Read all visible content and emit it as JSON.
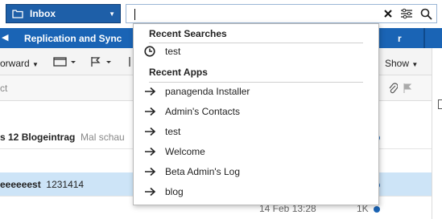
{
  "folder": {
    "label": "Inbox",
    "icon": "folder-icon"
  },
  "search": {
    "value": "",
    "icons": [
      "clear-icon",
      "filter-icon",
      "search-icon"
    ]
  },
  "tabbar": {
    "tab_label": "Replication and Sync",
    "close_glyph": "x",
    "right_tab_fragment": "r"
  },
  "toolbar": {
    "forward_label": "orward",
    "show_label": "Show"
  },
  "column_header": {
    "subject_fragment": "ct"
  },
  "rows": [
    {
      "subject": "s 12 Blogeintrag",
      "preview": "Mal schau"
    },
    {
      "subject": "eeeeeest",
      "preview": "1231414"
    }
  ],
  "bottom_row": {
    "date": "14 Feb 13:28",
    "size": "1K"
  },
  "dropdown": {
    "recent_searches_title": "Recent Searches",
    "recent_searches": [
      {
        "label": "test",
        "icon": "clock-icon"
      }
    ],
    "recent_apps_title": "Recent Apps",
    "recent_apps": [
      {
        "label": "panagenda Installer",
        "icon": "arrow-right-icon"
      },
      {
        "label": "Admin's Contacts",
        "icon": "arrow-right-icon"
      },
      {
        "label": "test",
        "icon": "arrow-right-icon"
      },
      {
        "label": "Welcome",
        "icon": "arrow-right-icon"
      },
      {
        "label": "Beta Admin's Log",
        "icon": "arrow-right-icon"
      },
      {
        "label": "blog",
        "icon": "arrow-right-icon"
      }
    ]
  },
  "colors": {
    "accent": "#1a64b5",
    "selected_row": "#cde4f7"
  }
}
